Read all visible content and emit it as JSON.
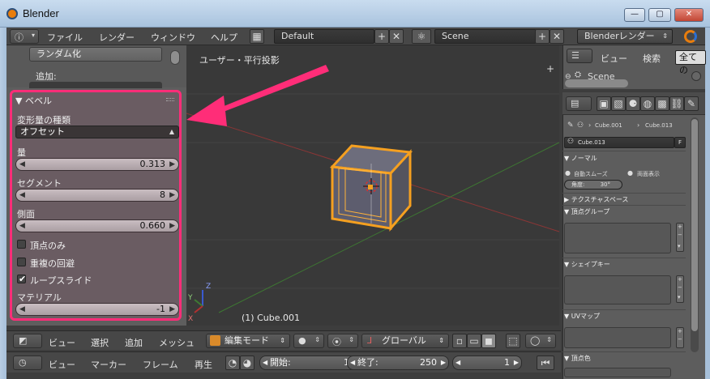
{
  "window": {
    "title": "Blender",
    "min": "—",
    "max": "▢",
    "close": "✕"
  },
  "header": {
    "menus": [
      "ファイル",
      "レンダー",
      "ウィンドウ",
      "ヘルプ"
    ],
    "layout": "Default",
    "scene": "Scene",
    "engine": "Blenderレンダー"
  },
  "tool_panel": {
    "random_button": "ランダム化",
    "add_label": "追加:"
  },
  "bevel": {
    "title": "ベベル",
    "transform_type_label": "変形量の種類",
    "transform_type_value": "オフセット",
    "amount_label": "量",
    "amount_value": "0.313",
    "segments_label": "セグメント",
    "segments_value": "8",
    "profile_label": "側面",
    "profile_value": "0.660",
    "vertex_only": {
      "label": "頂点のみ",
      "checked": false
    },
    "clamp_overlap": {
      "label": "重複の回避",
      "checked": false
    },
    "loop_slide": {
      "label": "ループスライド",
      "checked": true
    },
    "material_label": "マテリアル",
    "material_value": "-1"
  },
  "viewport": {
    "view_label": "ユーザー・平行投影",
    "object_label": "(1) Cube.001",
    "axis_x": "X",
    "axis_y": "Y",
    "axis_z": "Z"
  },
  "outliner": {
    "menu_view": "ビュー",
    "menu_search": "検索",
    "menu_all": "全ての",
    "scene_item": "Scene"
  },
  "properties": {
    "breadcrumb_mesh": "Cube.001",
    "breadcrumb_object": "Cube.013",
    "mesh_name": "Cube.013",
    "f_button": "F",
    "normals_title": "ノーマル",
    "auto_smooth": "自動スムーズ",
    "double_sided": "両面表示",
    "angle_label": "角度:",
    "angle_value": "30°",
    "texture_space_title": "テクスチャスペース",
    "vertex_groups_title": "頂点グループ",
    "shape_keys_title": "シェイプキー",
    "uv_maps_title": "UVマップ",
    "vertex_colors_title": "頂点色"
  },
  "view3d_bar": {
    "menus": [
      "ビュー",
      "選択",
      "追加",
      "メッシュ"
    ],
    "mode": "編集モード",
    "orientation": "グローバル"
  },
  "timeline": {
    "menus": [
      "ビュー",
      "マーカー",
      "フレーム",
      "再生"
    ],
    "start_label": "開始:",
    "start_value": "1",
    "end_label": "終了:",
    "end_value": "250",
    "current_value": "1"
  },
  "colors": {
    "highlight": "#ff2d78",
    "select": "#f5a020",
    "x_axis": "#b03030",
    "y_axis": "#4a9a3a",
    "z_axis": "#3a5ad0"
  }
}
